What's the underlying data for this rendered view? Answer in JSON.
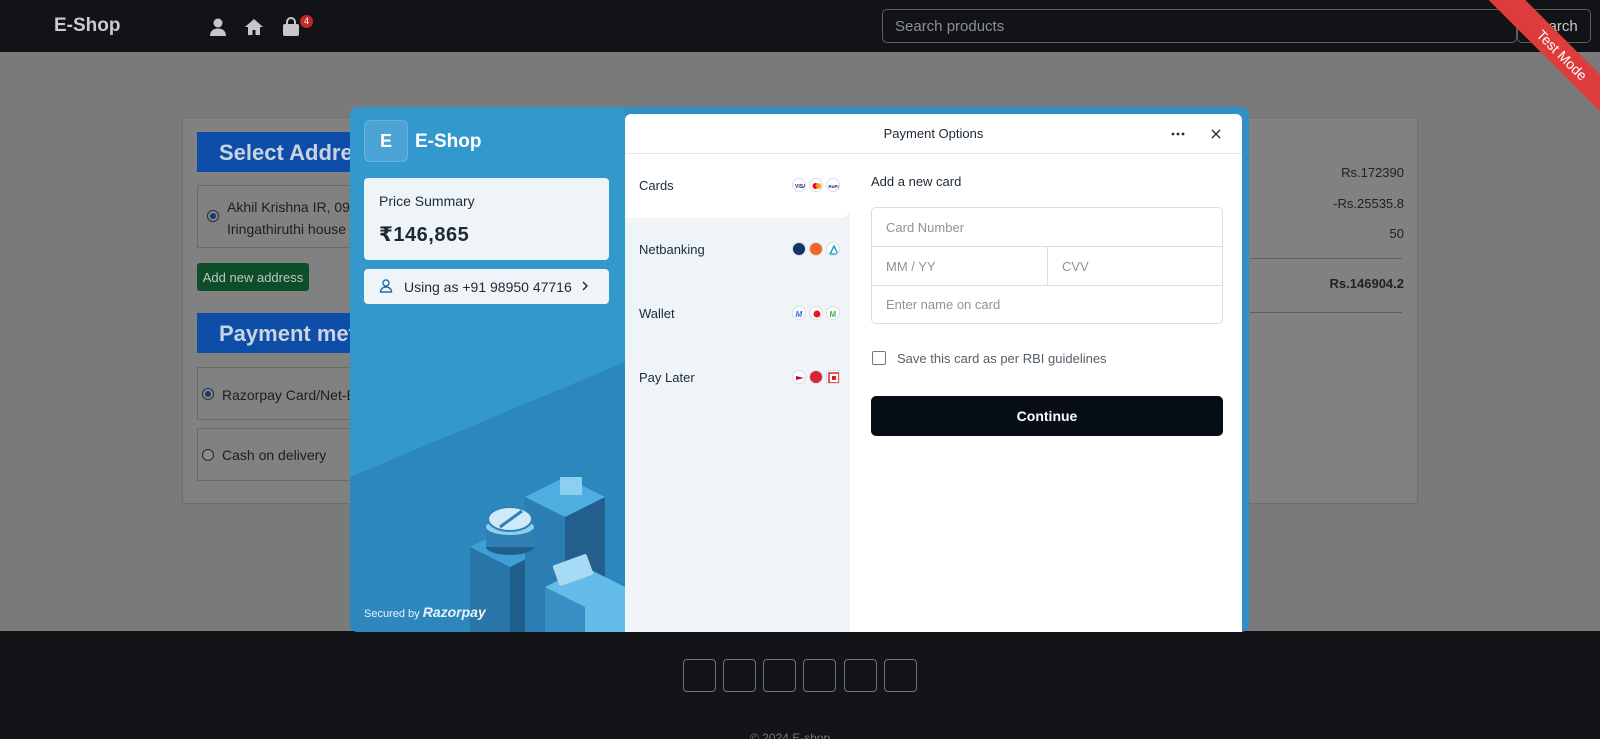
{
  "navbar": {
    "brand": "E-Shop",
    "cart_count": "4",
    "search_placeholder": "Search products",
    "search_button": "Search"
  },
  "ribbon": {
    "label": "Test Mode"
  },
  "address_section": {
    "title": "Select Address",
    "address_line_1": "Akhil Krishna IR, 09",
    "address_line_2": "Iringathiruthi house",
    "add_button": "Add new address"
  },
  "payment_section": {
    "title": "Payment method",
    "options": [
      "Razorpay Card/Net-Banking",
      "Cash on delivery"
    ]
  },
  "order_summary": {
    "subtotal": "Rs.172390",
    "discount": "-Rs.25535.8",
    "shipping": "50",
    "total": "Rs.146904.2"
  },
  "footer": {
    "social_buttons": [
      "",
      "",
      "",
      "",
      "",
      ""
    ],
    "copyright": "© 2024 E-shop"
  },
  "razorpay": {
    "merchant_initial": "E",
    "merchant_name": "E-Shop",
    "price_label": "Price Summary",
    "price_value": "₹146,865",
    "user_text": "Using as +91 98950 47716",
    "secured_by": "Secured by",
    "secured_brand": "Razorpay",
    "panel_title": "Payment Options",
    "methods": [
      {
        "label": "Cards",
        "logos": [
          "visa",
          "mastercard",
          "rupay"
        ]
      },
      {
        "label": "Netbanking",
        "logos": [
          "bank",
          "bank",
          "bank"
        ]
      },
      {
        "label": "Wallet",
        "logos": [
          "wallet",
          "wallet",
          "wallet"
        ]
      },
      {
        "label": "Pay Later",
        "logos": [
          "paylater",
          "paylater",
          "paylater"
        ]
      }
    ],
    "form_title": "Add a new card",
    "card_number_placeholder": "Card Number",
    "expiry_placeholder": "MM / YY",
    "cvv_placeholder": "CVV",
    "name_placeholder": "Enter name on card",
    "save_card_text": "Save this card as per RBI guidelines",
    "continue_button": "Continue"
  }
}
